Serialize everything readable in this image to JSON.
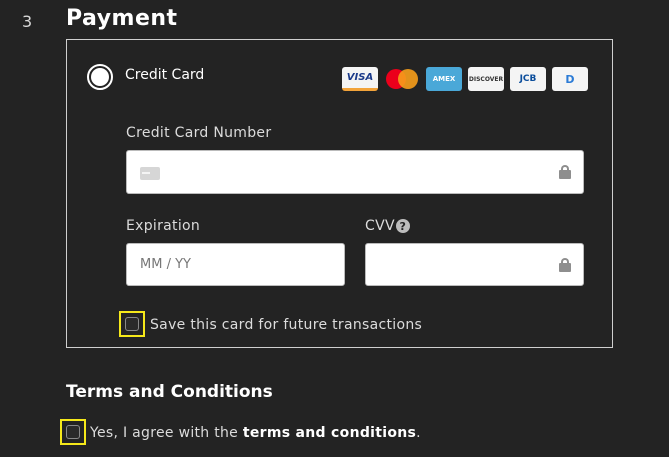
{
  "step": {
    "number": "3",
    "title": "Payment"
  },
  "payment": {
    "method_label": "Credit Card",
    "card_brands": [
      "visa-icon",
      "mastercard-icon",
      "amex-icon",
      "discover-icon",
      "jcb-icon",
      "diners-icon"
    ],
    "card_brand_text": {
      "visa": "VISA",
      "amex": "AMEX",
      "discover": "DISCOVER",
      "jcb": "JCB",
      "diners": "D"
    },
    "card_number": {
      "label": "Credit Card Number",
      "value": "",
      "placeholder": ""
    },
    "expiration": {
      "label": "Expiration",
      "placeholder": "MM / YY"
    },
    "cvv": {
      "label": "CVV",
      "help": "?",
      "value": ""
    },
    "save_card": {
      "label": "Save this card for future transactions",
      "checked": false
    }
  },
  "terms": {
    "title": "Terms and Conditions",
    "agree_prefix": "Yes, I agree with the ",
    "agree_link": "terms and conditions",
    "agree_suffix": ".",
    "checked": false
  },
  "colors": {
    "background": "#232323",
    "focus_outline": "#f5e81a",
    "border": "#cfcfcf"
  }
}
